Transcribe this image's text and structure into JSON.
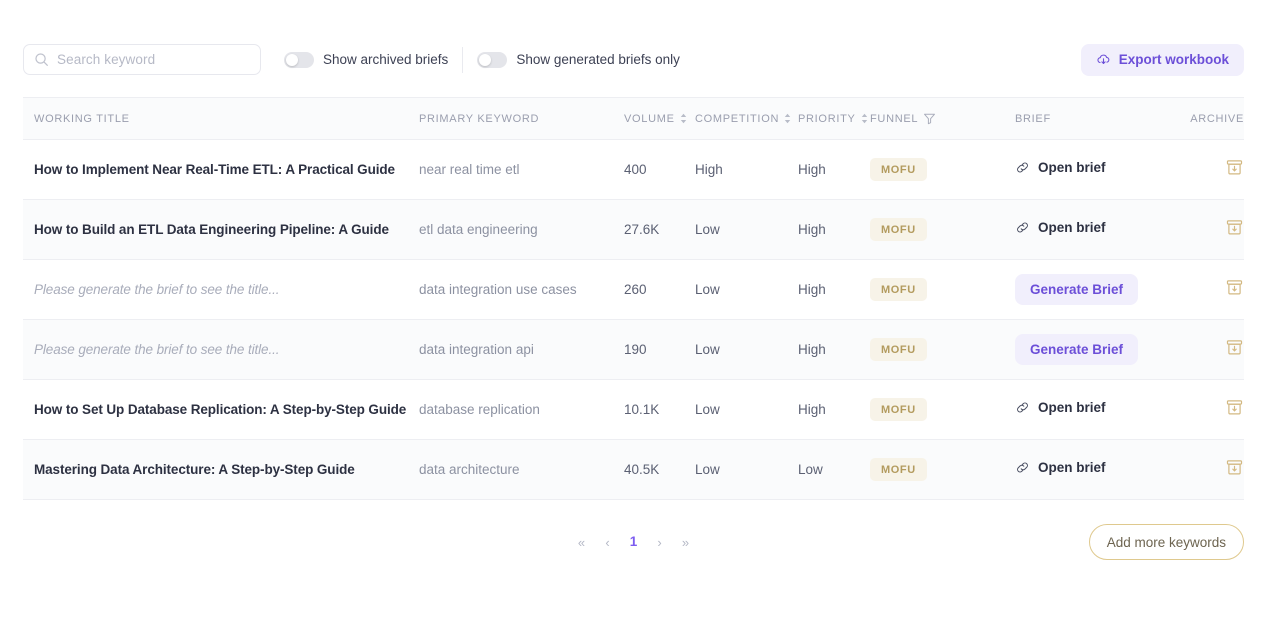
{
  "toolbar": {
    "search": {
      "placeholder": "Search keyword",
      "value": "",
      "icon": "search-icon"
    },
    "toggles": [
      {
        "label": "Show archived briefs",
        "on": false
      },
      {
        "label": "Show generated briefs only",
        "on": false
      }
    ],
    "export": {
      "label": "Export workbook",
      "icon": "cloud-download-icon"
    }
  },
  "table": {
    "columns": [
      {
        "key": "title",
        "label": "WORKING TITLE",
        "sortable": false,
        "filter": false
      },
      {
        "key": "keyword",
        "label": "PRIMARY KEYWORD",
        "sortable": false,
        "filter": false
      },
      {
        "key": "volume",
        "label": "VOLUME",
        "sortable": true,
        "filter": false
      },
      {
        "key": "comp",
        "label": "COMPETITION",
        "sortable": true,
        "filter": false
      },
      {
        "key": "prio",
        "label": "PRIORITY",
        "sortable": true,
        "filter": false
      },
      {
        "key": "funnel",
        "label": "FUNNEL",
        "sortable": false,
        "filter": true
      },
      {
        "key": "brief",
        "label": "BRIEF",
        "sortable": false,
        "filter": false
      },
      {
        "key": "archive",
        "label": "ARCHIVE",
        "sortable": false,
        "filter": false
      }
    ],
    "placeholder_title": "Please generate the brief to see the title...",
    "open_brief_label": "Open brief",
    "generate_brief_label": "Generate Brief",
    "rows": [
      {
        "title": "How to Implement Near Real-Time ETL: A Practical Guide",
        "is_placeholder": false,
        "keyword": "near real time etl",
        "volume": "400",
        "competition": "High",
        "priority": "High",
        "funnel": "MOFU",
        "brief_state": "open"
      },
      {
        "title": "How to Build an ETL Data Engineering Pipeline: A Guide",
        "is_placeholder": false,
        "keyword": "etl data engineering",
        "volume": "27.6K",
        "competition": "Low",
        "priority": "High",
        "funnel": "MOFU",
        "brief_state": "open"
      },
      {
        "title": "Please generate the brief to see the title...",
        "is_placeholder": true,
        "keyword": "data integration use cases",
        "volume": "260",
        "competition": "Low",
        "priority": "High",
        "funnel": "MOFU",
        "brief_state": "generate"
      },
      {
        "title": "Please generate the brief to see the title...",
        "is_placeholder": true,
        "keyword": "data integration api",
        "volume": "190",
        "competition": "Low",
        "priority": "High",
        "funnel": "MOFU",
        "brief_state": "generate"
      },
      {
        "title": "How to Set Up Database Replication: A Step-by-Step Guide",
        "is_placeholder": false,
        "keyword": "database replication",
        "volume": "10.1K",
        "competition": "Low",
        "priority": "High",
        "funnel": "MOFU",
        "brief_state": "open"
      },
      {
        "title": "Mastering Data Architecture: A Step-by-Step Guide",
        "is_placeholder": false,
        "keyword": "data architecture",
        "volume": "40.5K",
        "competition": "Low",
        "priority": "Low",
        "funnel": "MOFU",
        "brief_state": "open"
      }
    ]
  },
  "footer": {
    "pagination": {
      "first": "«",
      "prev": "‹",
      "current_page": "1",
      "next": "›",
      "last": "»"
    },
    "add_keywords_label": "Add more keywords"
  },
  "colors": {
    "accent_purple": "#6c4fd8",
    "accent_purple_soft": "#f1effc",
    "badge_bg": "#f7f3e8",
    "badge_text": "#b39b5e",
    "gold": "#d9c084",
    "row_alt": "#fafbfc",
    "border": "#edeef2"
  }
}
